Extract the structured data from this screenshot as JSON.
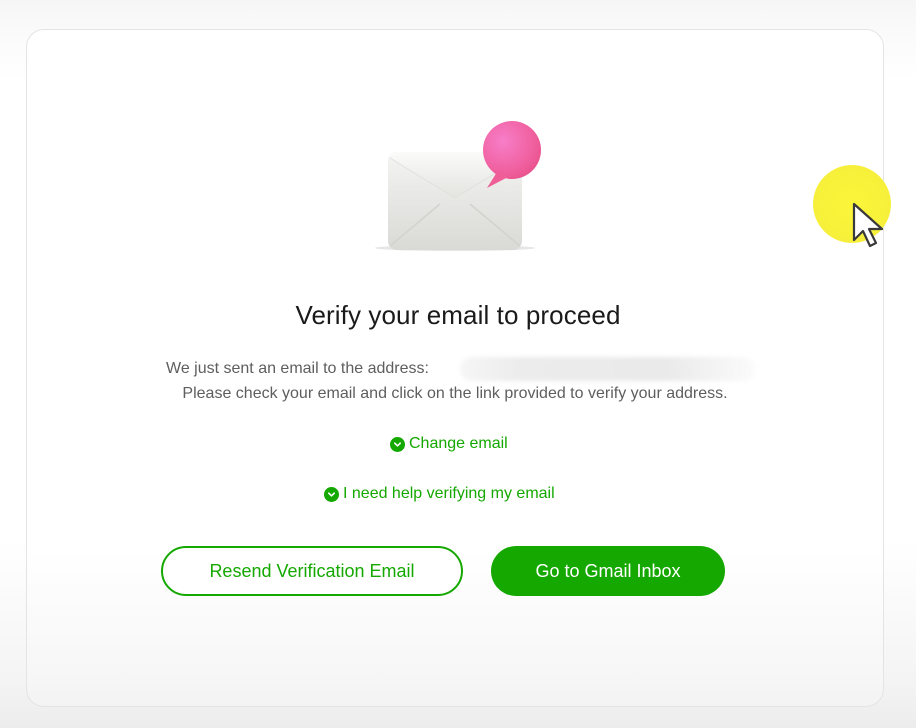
{
  "dialog": {
    "title": "Verify your email to proceed",
    "message_line1": "We just sent an email to the address:",
    "message_line2": "Please check your email and click on the link provided to verify your address."
  },
  "links": {
    "change_email": "Change email",
    "help_verifying": "I need help verifying my email"
  },
  "buttons": {
    "resend": "Resend Verification Email",
    "gmail": "Go to Gmail Inbox"
  },
  "icons": {
    "illustration": "envelope-with-notification-icon",
    "link_marker": "chevron-down-circle-icon",
    "pointer": "mouse-pointer-icon"
  },
  "colors": {
    "accent": "#14a800",
    "notification": "#f06ab0",
    "cursor_highlight": "#f7f13a"
  }
}
